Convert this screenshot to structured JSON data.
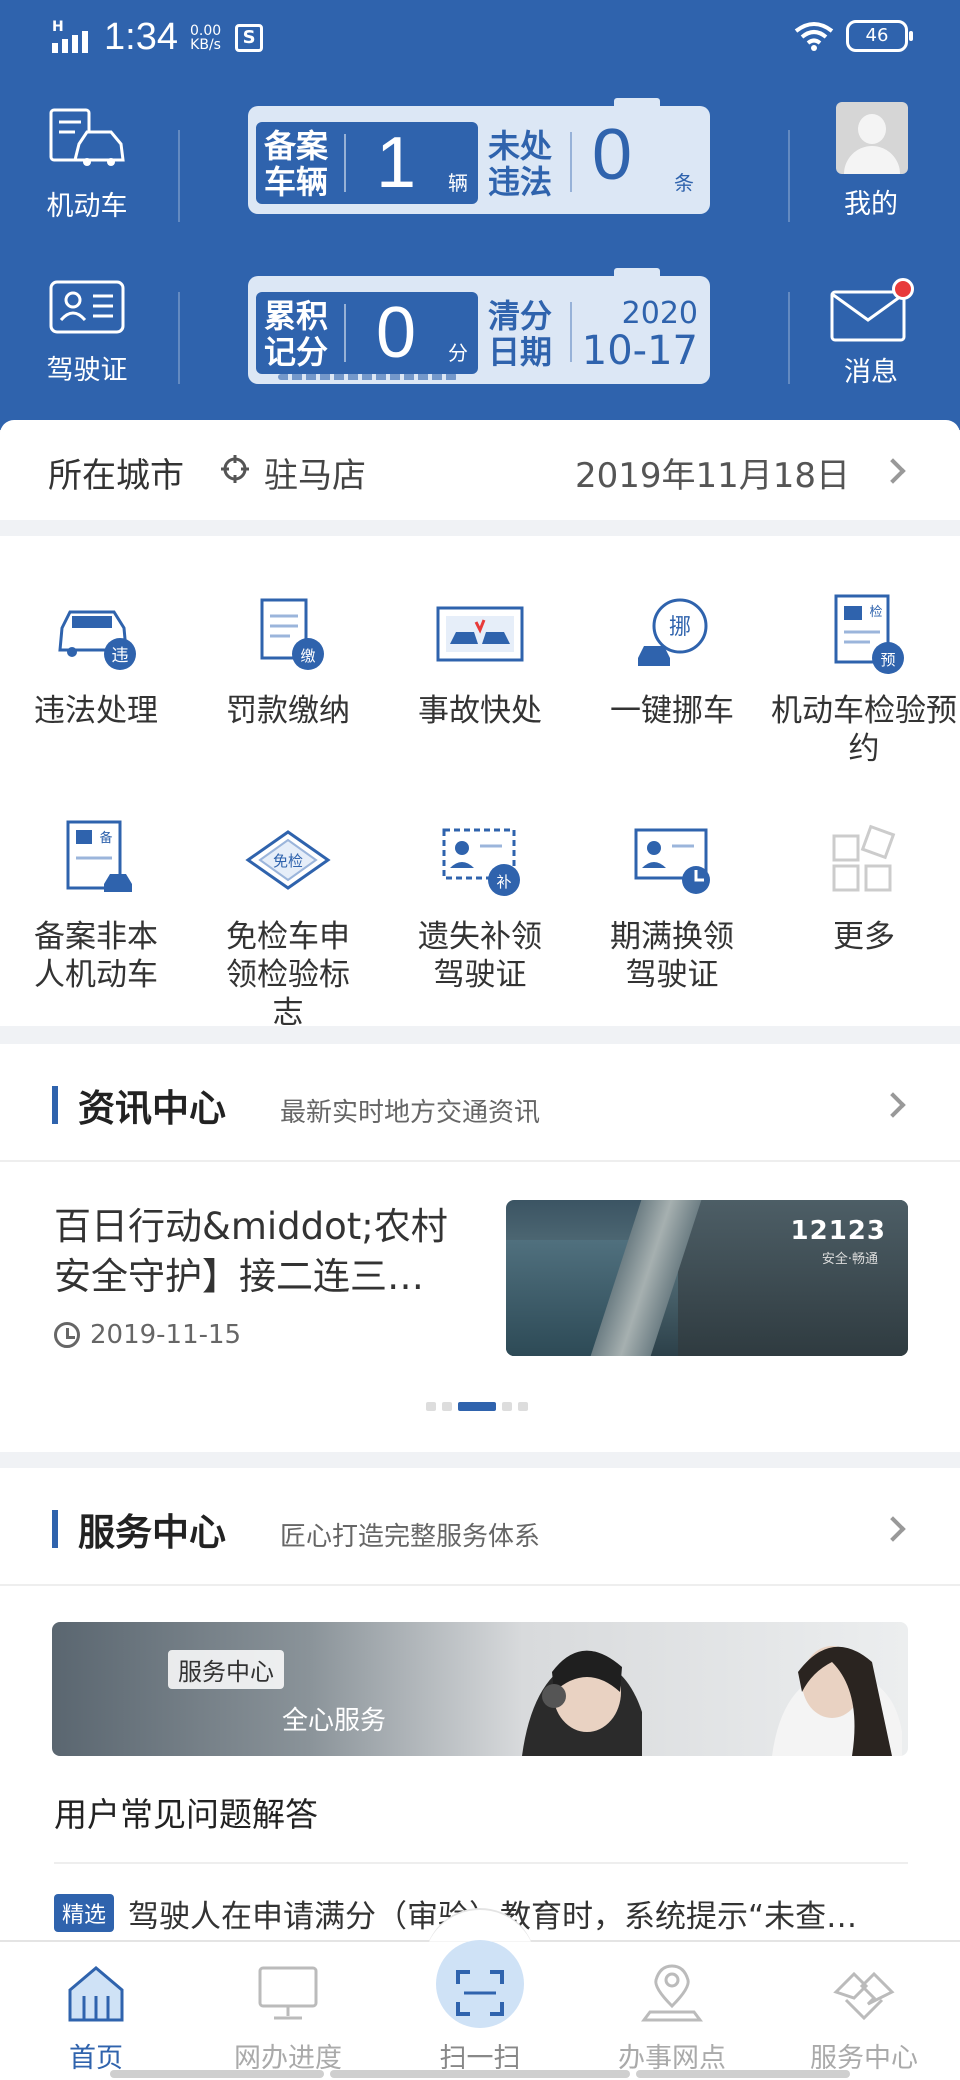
{
  "status_bar": {
    "time": "1:34",
    "speed_value": "0.00",
    "speed_unit": "KB/s",
    "signal_label": "H",
    "battery": "46",
    "app_badge": "S"
  },
  "header": {
    "vehicle_tile": "机动车",
    "license_tile": "驾驶证",
    "profile_tile": "我的",
    "message_tile": "消息",
    "card1": {
      "left_key_1": "备案",
      "left_key_2": "车辆",
      "left_value": "1",
      "left_unit": "辆",
      "right_key_1": "未处",
      "right_key_2": "违法",
      "right_value": "0",
      "right_unit": "条"
    },
    "card2": {
      "left_key_1": "累积",
      "left_key_2": "记分",
      "left_value": "0",
      "left_unit": "分",
      "right_key_1": "清分",
      "right_key_2": "日期",
      "date_year": "2020",
      "date_md": "10-17"
    }
  },
  "city_row": {
    "label": "所在城市",
    "city": "驻马店",
    "date": "2019年11月18日"
  },
  "services": [
    {
      "label": "违法处理",
      "icon": "car-violation-icon"
    },
    {
      "label": "罚款缴纳",
      "icon": "fine-payment-icon"
    },
    {
      "label": "事故快处",
      "icon": "accident-icon"
    },
    {
      "label": "一键挪车",
      "icon": "move-car-icon"
    },
    {
      "label": "机动车检验预约",
      "icon": "inspection-appointment-icon"
    },
    {
      "label": "备案非本人机动车",
      "icon": "register-vehicle-icon"
    },
    {
      "label": "免检车申领检验标志",
      "icon": "exempt-inspection-icon"
    },
    {
      "label": "遗失补领驾驶证",
      "icon": "reissue-license-icon"
    },
    {
      "label": "期满换领驾驶证",
      "icon": "renew-license-icon"
    },
    {
      "label": "更多",
      "icon": "more-icon"
    }
  ],
  "news": {
    "title": "资讯中心",
    "subtitle": "最新实时地方交通资讯",
    "headline": "百日行动&middot;农村安全守护】接二连三…",
    "date": "2019-11-15",
    "image_brand": "12123",
    "image_slogan": "安全·畅通"
  },
  "service_center": {
    "title": "服务中心",
    "subtitle": "匠心打造完整服务体系",
    "banner_tag": "服务中心",
    "banner_sub": "全心服务",
    "faq_title": "用户常见问题解答",
    "faq_tag": "精选",
    "faq_text": "驾驶人在申请满分（审验）教育时，系统提示“未查…"
  },
  "bottom_nav": [
    {
      "label": "首页"
    },
    {
      "label": "网办进度"
    },
    {
      "label": "扫一扫"
    },
    {
      "label": "办事网点"
    },
    {
      "label": "服务中心"
    }
  ],
  "colors": {
    "primary": "#2f63ad",
    "card_light": "#dce7f5",
    "alert": "#e83a3a"
  }
}
